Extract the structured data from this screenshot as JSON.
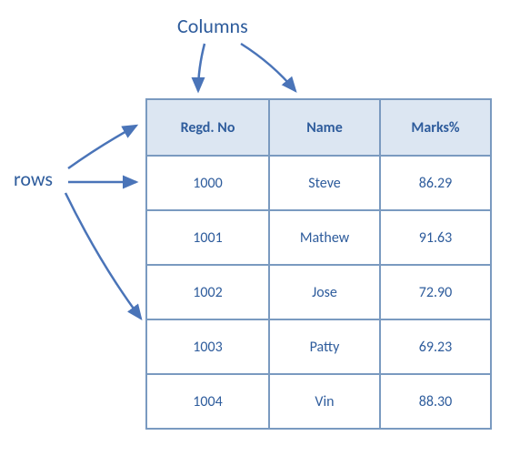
{
  "labels": {
    "columns": "Columns",
    "rows": "rows"
  },
  "table": {
    "headers": [
      "Regd. No",
      "Name",
      "Marks%"
    ],
    "rows": [
      {
        "regd": "1000",
        "name": "Steve",
        "marks": "86.29"
      },
      {
        "regd": "1001",
        "name": "Mathew",
        "marks": "91.63"
      },
      {
        "regd": "1002",
        "name": "Jose",
        "marks": "72.90"
      },
      {
        "regd": "1003",
        "name": "Patty",
        "marks": "69.23"
      },
      {
        "regd": "1004",
        "name": "Vin",
        "marks": "88.30"
      }
    ]
  }
}
